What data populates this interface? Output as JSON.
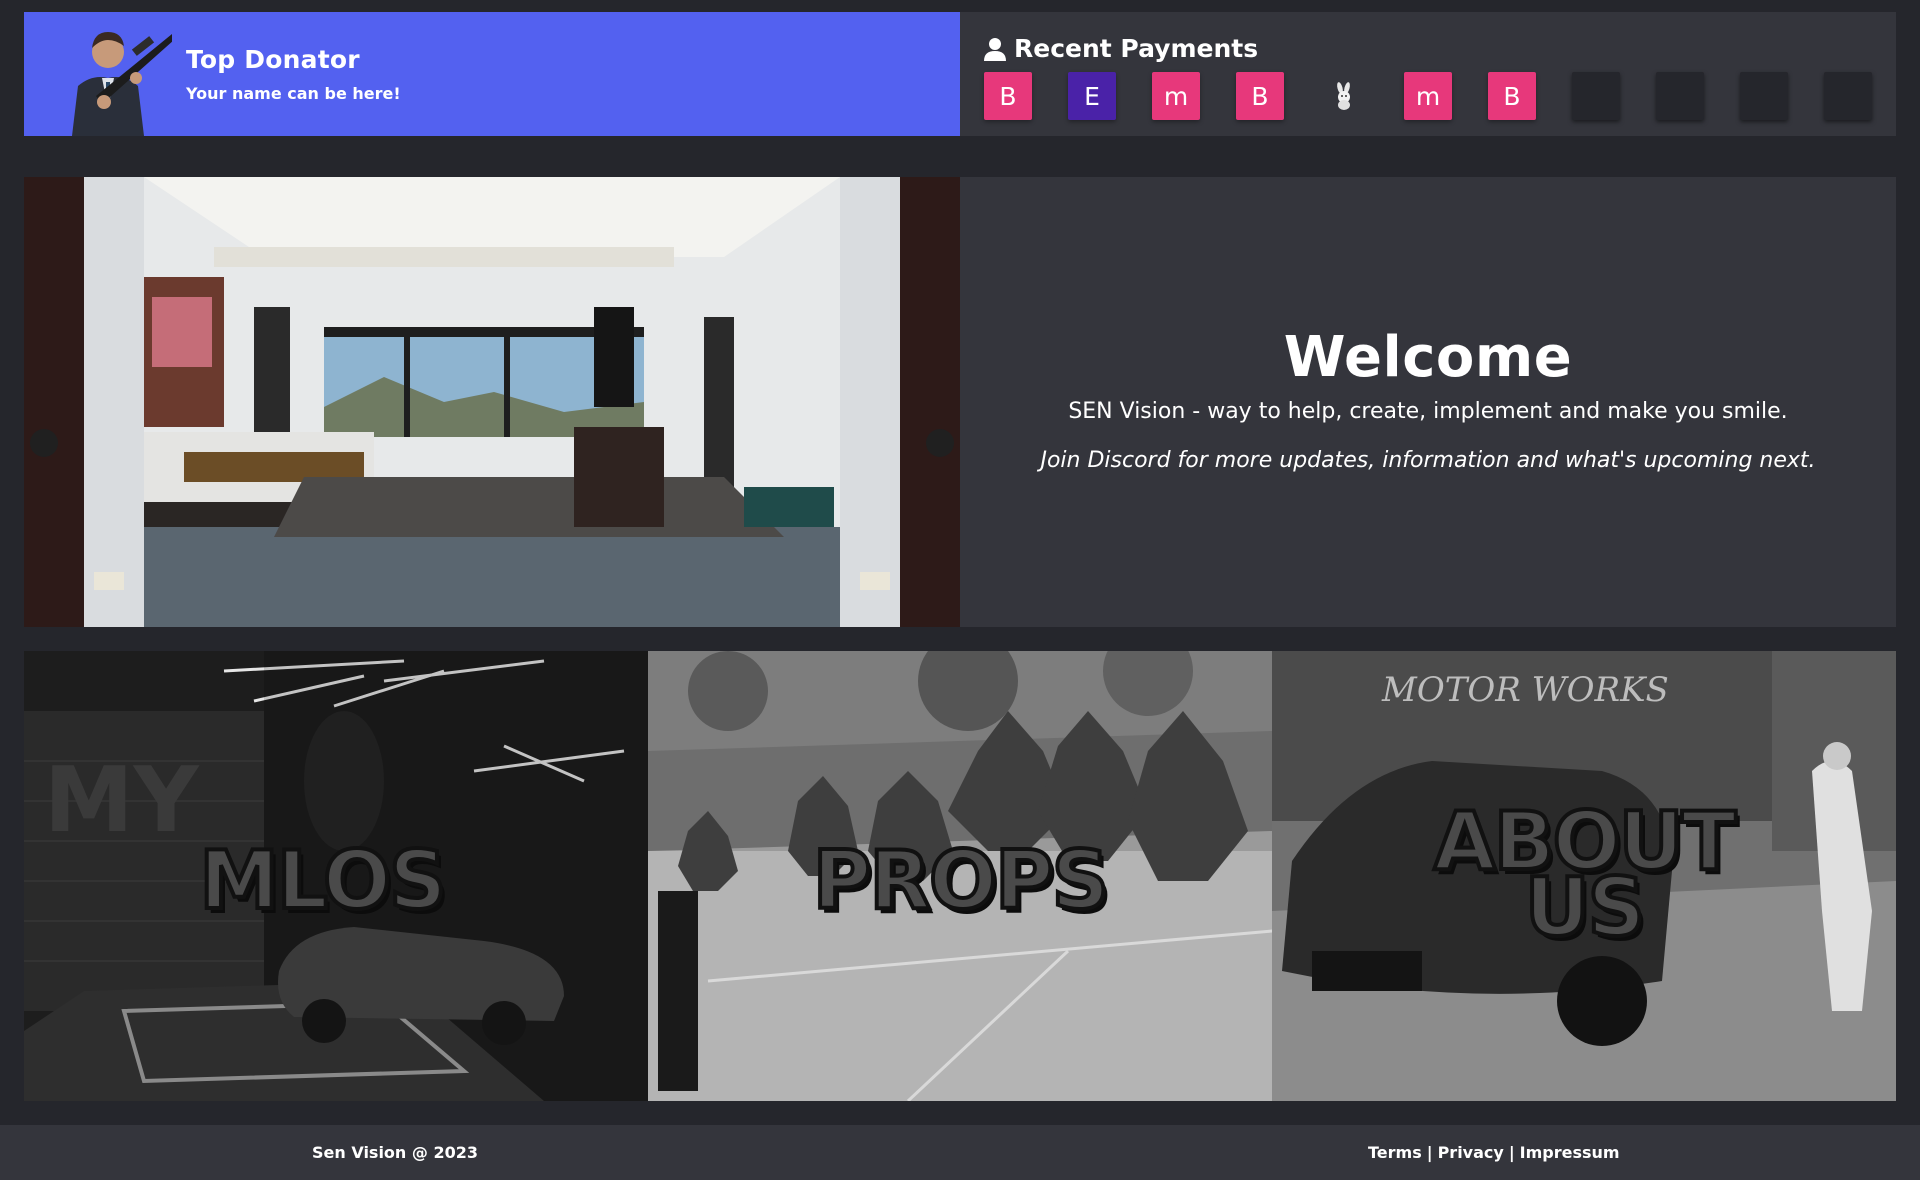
{
  "top_donator": {
    "title": "Top Donator",
    "subtitle": "Your name can be here!",
    "accent": "#5361f0"
  },
  "recent_payments": {
    "title": "Recent Payments",
    "icon": "user-icon",
    "items": [
      {
        "letter": "B",
        "color": "#e7387b"
      },
      {
        "letter": "E",
        "color": "#4a22a8"
      },
      {
        "letter": "m",
        "color": "#e7387b"
      },
      {
        "letter": "B",
        "color": "#e7387b"
      },
      {
        "letter": "",
        "icon": "bunny-icon"
      },
      {
        "letter": "m",
        "color": "#e7387b"
      },
      {
        "letter": "B",
        "color": "#e7387b"
      },
      {
        "letter": ""
      },
      {
        "letter": ""
      },
      {
        "letter": ""
      },
      {
        "letter": ""
      }
    ]
  },
  "welcome": {
    "title": "Welcome",
    "line1": "SEN Vision - way to help, create, implement and make you smile.",
    "line2": "Join Discord for more updates, information and what's upcoming next."
  },
  "tiles": [
    {
      "label": "MLOS"
    },
    {
      "label": "PROPS"
    },
    {
      "label_line1": "ABOUT",
      "label_line2": "US"
    }
  ],
  "footer": {
    "copyright": "Sen Vision @ 2023",
    "links": [
      "Terms",
      "Privacy",
      "Impressum"
    ],
    "separator": "|"
  }
}
